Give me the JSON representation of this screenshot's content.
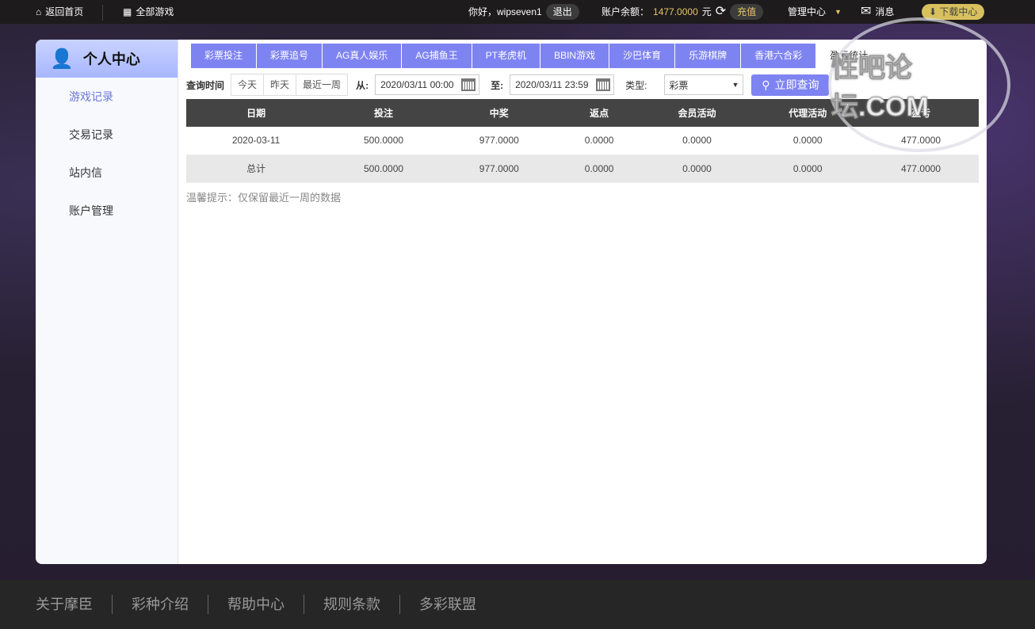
{
  "topbar": {
    "home": "返回首页",
    "all_games": "全部游戏",
    "greeting": "你好，wipseven1",
    "logout": "退出",
    "balance_label": "账户余额：",
    "balance": "1477.0000",
    "currency": "元",
    "recharge": "充值",
    "manage": "管理中心",
    "messages": "消息",
    "download": "下载中心"
  },
  "sidebar": {
    "title": "个人中心",
    "items": [
      {
        "label": "游戏记录"
      },
      {
        "label": "交易记录"
      },
      {
        "label": "站内信"
      },
      {
        "label": "账户管理"
      }
    ]
  },
  "tabs": [
    "彩票投注",
    "彩票追号",
    "AG真人娱乐",
    "AG捕鱼王",
    "PT老虎机",
    "BBIN游戏",
    "沙巴体育",
    "乐游棋牌",
    "香港六合彩",
    "盈亏统计"
  ],
  "query": {
    "label": "查询时间",
    "quick": [
      "今天",
      "昨天",
      "最近一周"
    ],
    "from_label": "从:",
    "from": "2020/03/11 00:00",
    "to_label": "至:",
    "to": "2020/03/11 23:59",
    "type_label": "类型:",
    "type": "彩票",
    "search": "立即查询"
  },
  "table": {
    "headers": [
      "日期",
      "投注",
      "中奖",
      "返点",
      "会员活动",
      "代理活动",
      "盈亏"
    ],
    "rows": [
      [
        "2020-03-11",
        "500.0000",
        "977.0000",
        "0.0000",
        "0.0000",
        "0.0000",
        "477.0000"
      ]
    ],
    "total": [
      "总计",
      "500.0000",
      "977.0000",
      "0.0000",
      "0.0000",
      "0.0000",
      "477.0000"
    ]
  },
  "tip": "温馨提示：仅保留最近一周的数据",
  "footer": [
    "关于摩臣",
    "彩种介绍",
    "帮助中心",
    "规则条款",
    "多彩联盟"
  ],
  "watermark": "性吧论坛.COM"
}
